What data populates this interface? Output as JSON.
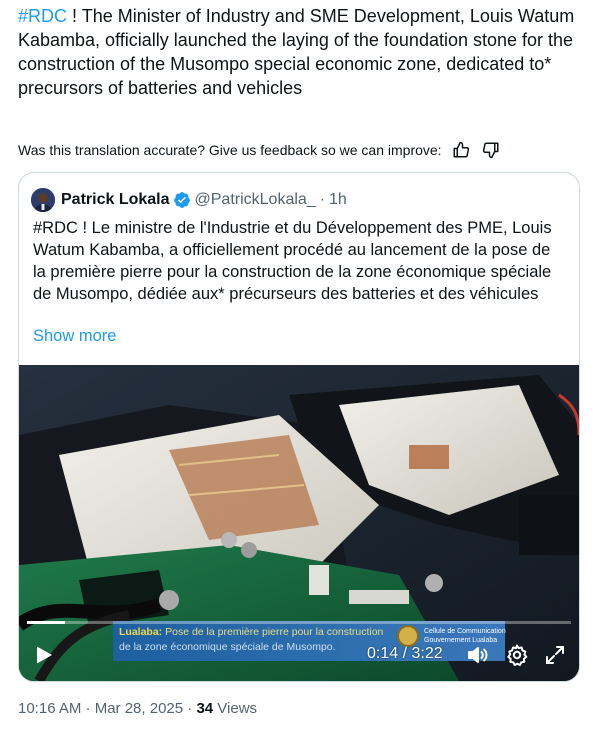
{
  "tweet": {
    "hashtag": "#RDC",
    "translated_text": " ! The Minister of Industry and SME Development, Louis Watum Kabamba, officially launched the laying of the foundation stone for the construction of the Musompo special economic zone, dedicated to* precursors of batteries and vehicles",
    "feedback_prompt": "Was this translation accurate? Give us feedback so we can improve:",
    "thumbs_up_icon": "thumbs-up-icon",
    "thumbs_down_icon": "thumbs-down-icon"
  },
  "quote": {
    "author_name": "Patrick Lokala",
    "handle": "@PatrickLokala_",
    "separator": "·",
    "time": "1h",
    "text": "#RDC ! Le ministre de l'Industrie et du Développement des PME, Louis Watum Kabamba, a officiellement procédé au lancement de la pose de la première pierre pour la construction de la zone économique spéciale de Musompo, dédiée aux* précurseurs des batteries et des véhicules",
    "show_more": "Show more",
    "verified_color": "#1d9bf0"
  },
  "video": {
    "caption_location": "Lualaba:",
    "caption_line1": " Pose de la première pierre pour la construction",
    "caption_line2": "de la zone économique spéciale de Musompo.",
    "seal_text_1": "Cellule de Communication",
    "seal_text_2": "Gouvernement Lualaba",
    "current_time": "0:14",
    "time_separator": " / ",
    "duration": "3:22",
    "progress": 0.07
  },
  "meta": {
    "timestamp": "10:16 AM · Mar 28, 2025 · ",
    "views_count": "34",
    "views_label": " Views"
  },
  "colors": {
    "link": "#1d9bf0",
    "text": "#0f1419",
    "secondary": "#536471",
    "border": "#cfd9de"
  }
}
